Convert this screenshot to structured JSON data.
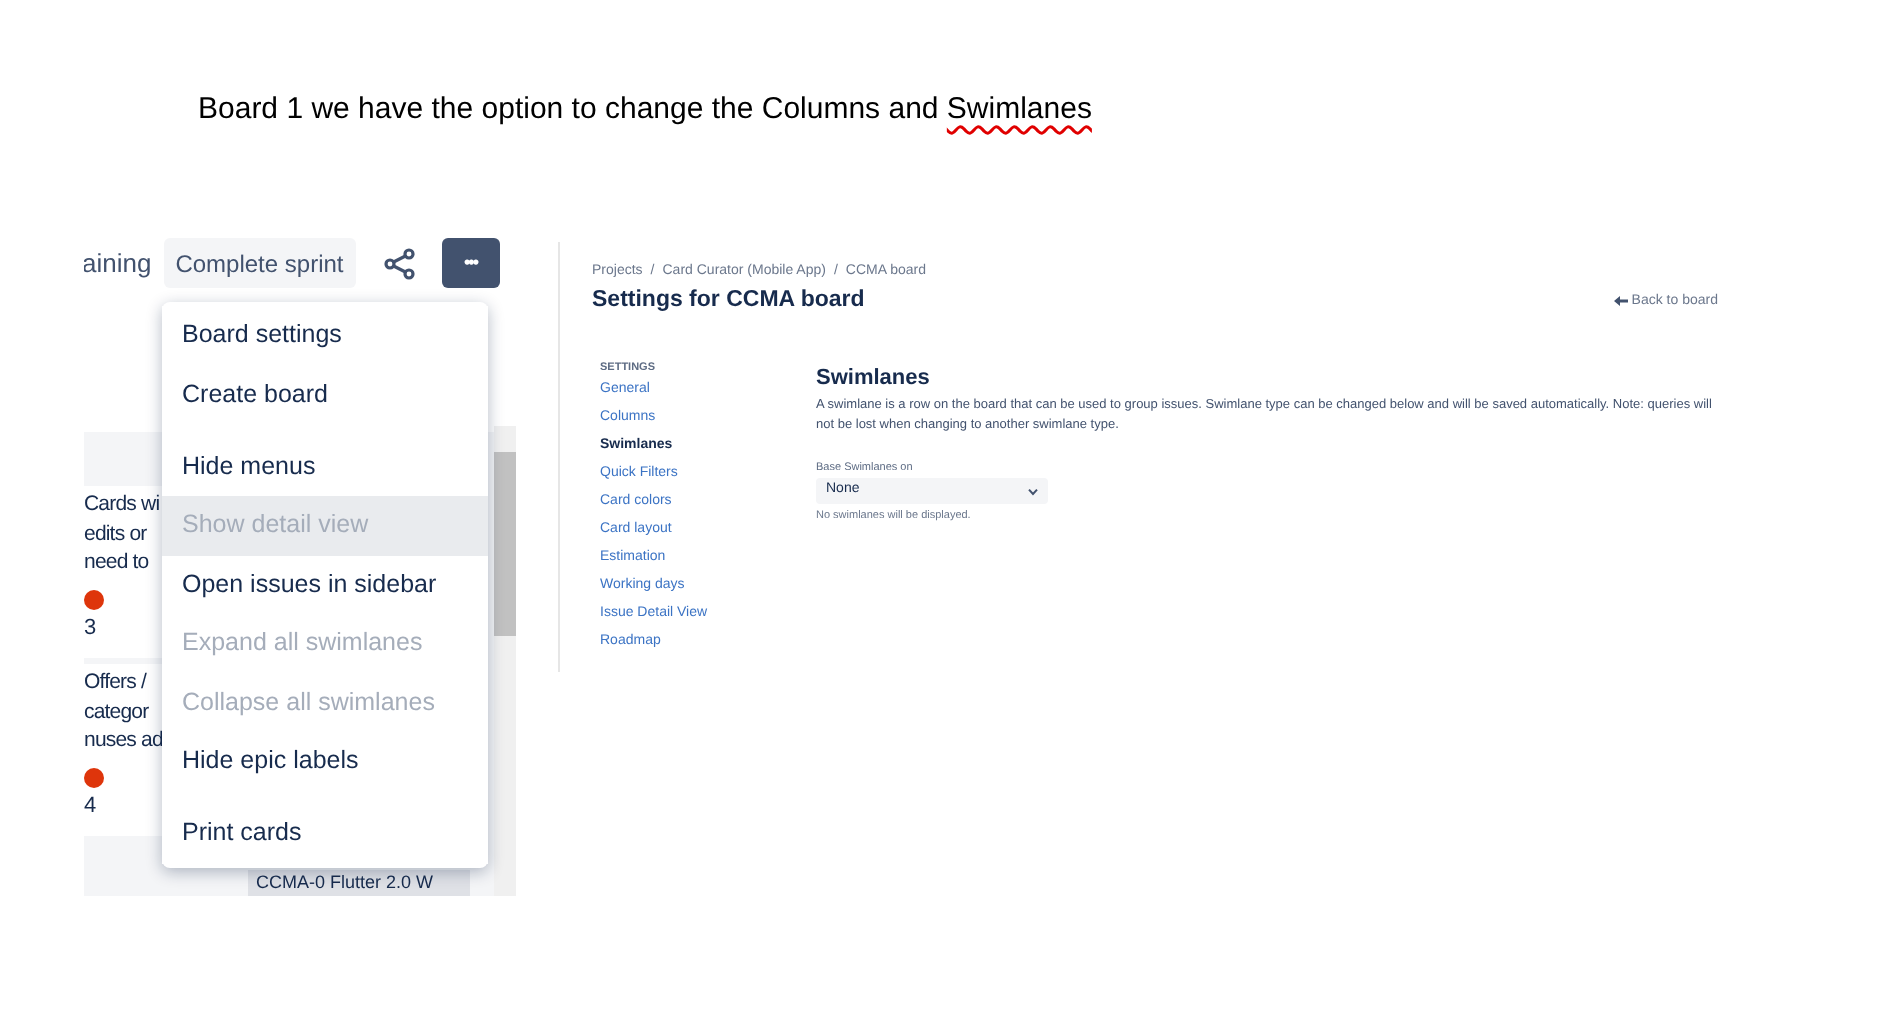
{
  "caption": {
    "segments": [
      {
        "text": "Board 1 we have the option to change the Columns and ",
        "misspelled": false
      },
      {
        "text": "Swimlanes",
        "misspelled": true
      }
    ]
  },
  "board_screenshot": {
    "toolbar": {
      "cut_label": "aining",
      "complete_button": "Complete sprint",
      "more_button": "•••"
    },
    "cards": [
      {
        "lines": [
          "Cards wi",
          "edits or",
          "need to"
        ],
        "count": "3"
      },
      {
        "lines": [
          "Offers /",
          "categor",
          "nuses ad"
        ],
        "count": "4"
      }
    ],
    "bottom_card": "CCMA-0 Flutter 2.0 W",
    "menu": {
      "sections": [
        {
          "items": [
            {
              "label": "Board settings",
              "disabled": false,
              "hovered": false
            },
            {
              "label": "Create board",
              "disabled": false,
              "hovered": false
            }
          ]
        },
        {
          "items": [
            {
              "label": "Hide menus",
              "disabled": false,
              "hovered": false
            },
            {
              "label": "Show detail view",
              "disabled": true,
              "hovered": true
            },
            {
              "label": "Open issues in sidebar",
              "disabled": false,
              "hovered": false
            },
            {
              "label": "Expand all swimlanes",
              "disabled": true,
              "hovered": false
            },
            {
              "label": "Collapse all swimlanes",
              "disabled": true,
              "hovered": false
            },
            {
              "label": "Hide epic labels",
              "disabled": false,
              "hovered": false
            }
          ]
        },
        {
          "items": [
            {
              "label": "Print cards",
              "disabled": false,
              "hovered": false
            }
          ]
        }
      ]
    }
  },
  "settings_screenshot": {
    "breadcrumb": [
      {
        "label": "Projects"
      },
      {
        "separator": "/",
        "label": "Card Curator (Mobile App)"
      },
      {
        "separator": "/",
        "label": "CCMA board"
      }
    ],
    "title": "Settings for CCMA board",
    "back_link": "Back to board",
    "sidebar": {
      "heading": "SETTINGS",
      "items": [
        {
          "label": "General",
          "selected": false
        },
        {
          "label": "Columns",
          "selected": false
        },
        {
          "label": "Swimlanes",
          "selected": true
        },
        {
          "label": "Quick Filters",
          "selected": false
        },
        {
          "label": "Card colors",
          "selected": false
        },
        {
          "label": "Card layout",
          "selected": false
        },
        {
          "label": "Estimation",
          "selected": false
        },
        {
          "label": "Working days",
          "selected": false
        },
        {
          "label": "Issue Detail View",
          "selected": false
        },
        {
          "label": "Roadmap",
          "selected": false
        }
      ]
    },
    "section_title": "Swimlanes",
    "description": "A swimlane is a row on the board that can be used to group issues. Swimlane type can be changed below and will be saved automatically. Note: queries will not be lost when changing to another swimlane type.",
    "field_label": "Base Swimlanes on",
    "select_value": "None",
    "helper": "No swimlanes will be displayed."
  }
}
